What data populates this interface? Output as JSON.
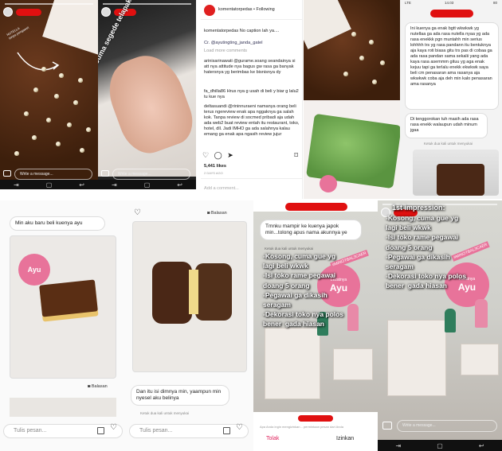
{
  "panel1": {
    "input_placeholder": "Write a message...",
    "caption_part1": "NUTELLA",
    "caption_part2": "tanpa pengawet"
  },
  "panel2": {
    "overlay": "Cuma segede telapak tangan gue",
    "input_placeholder": "Write a message..."
  },
  "panel3": {
    "account": "komentatorpedas",
    "follow": "• Following",
    "caption": "komentatorpedas No caption lah ya....",
    "credit": "Cr. @ayutingting_janda_gatel",
    "load_more": "Load more comments",
    "comments": [
      "arinisarinawati @gurame.soang seandainya si att nya attitude nya bagus gw rasa ga banyak hatersnya yg berimbas ke bisnisnya dy",
      "fa_dhilla86 Hrus nya g usah di beli y biar g lalu2 tu kue nya",
      "deltasuandi @rininnuraeni namanya orang beli terus ngereview enak apa nggaknya ga salah kok. Tanpa review di socmed pribadi aja udah ada web2 buat review entah itu restaurant, toko, hotel, dll. Jadi IMHO ga ada salahnya kalau emang ga enak apa ngasih review jujur"
    ],
    "likes": "5,441 likes",
    "time": "2 DAYS AGO",
    "add_comment": "Add a comment..."
  },
  "panel5": {
    "time": "14.03",
    "carrier": "LTE",
    "battery": "80",
    "message1": "Ini kuenya ga enak bgtt wkwkwk yg nutellaa ga ada rasa nutella nyaa yg ada rasa enekkk pgn muntahh min serius lohhhh trs yg rasa pandann itu bentuknya aja kaya roti biasa gitu trs pas di cobaa ga ada rasa pandan sama sekalii yang ada kaya rasa asemmm gituu yg aga enak kejuu tapi ga terlalu enekk ekwkwk saya beli cm penasaran ama rasanya aja wkwkwk coba aja deh min kalo penasaran ama rasanya",
    "message2": "Di tenggorokan tuh masih ada rasa rasa enekk walaupun udah minum jgaa",
    "seen": "Ketuk dua kali untuk menyukai"
  },
  "panel6": {
    "bubble": "Min aku baru beli kuenya ayu",
    "reply": "Balasan",
    "input_placeholder": "Tulis pesan...",
    "box_label": "Ayu"
  },
  "panel7": {
    "reply": "Balasan",
    "message": "Dan itu isi dimnya min, yaampun min nyesel aku belinya",
    "tap_hint": "Ketuk dua kali untuk menyukai",
    "input_placeholder": "Tulis pesan..."
  },
  "panel8": {
    "message": "Tmnku mampir ke kuenya japok min...tolong apus nama akunnya ye",
    "tap_hint": "Ketuk dua kali untuk menyukai",
    "overlay": "-Kosong, cuma gue yg\nlagi beli wkwk\n-Isi toko rame pegawai\ndoang 5 orang\n-Pegawai ga dikasih\nseragam\n-Dekorasi toko nya polos\nbener  gada hiasan",
    "deny": "Tolak",
    "allow": "Izinkan",
    "request": "Apa Anda ingin mengizinkan... permintaan pesan dari Anda",
    "hashtag": "#MINOTBAL3CAER",
    "logo": "Ayu",
    "logo_small": "Lezatnya"
  },
  "panel9": {
    "title": "1st impression:",
    "overlay": "-Kosong, cuma gue yg\nlagi beli wkwk\n-Isi toko rame pegawai\ndoang 5 orang\n-Pegawai ga dikasih\nseragam\n-Dekorasi toko nya polos\nbener  gada hiasan",
    "input_placeholder": "Write a message...",
    "hashtag": "#MINOTBAL3CAER",
    "logo": "Ayu",
    "logo_small": "Lezatnya"
  },
  "icons": {
    "camera": "camera-icon",
    "heart": "heart-icon",
    "comment": "comment-icon",
    "share": "share-icon",
    "bookmark": "bookmark-icon",
    "gallery": "gallery-icon",
    "back": "back-icon",
    "home": "home-icon",
    "recent": "recent-apps-icon"
  }
}
